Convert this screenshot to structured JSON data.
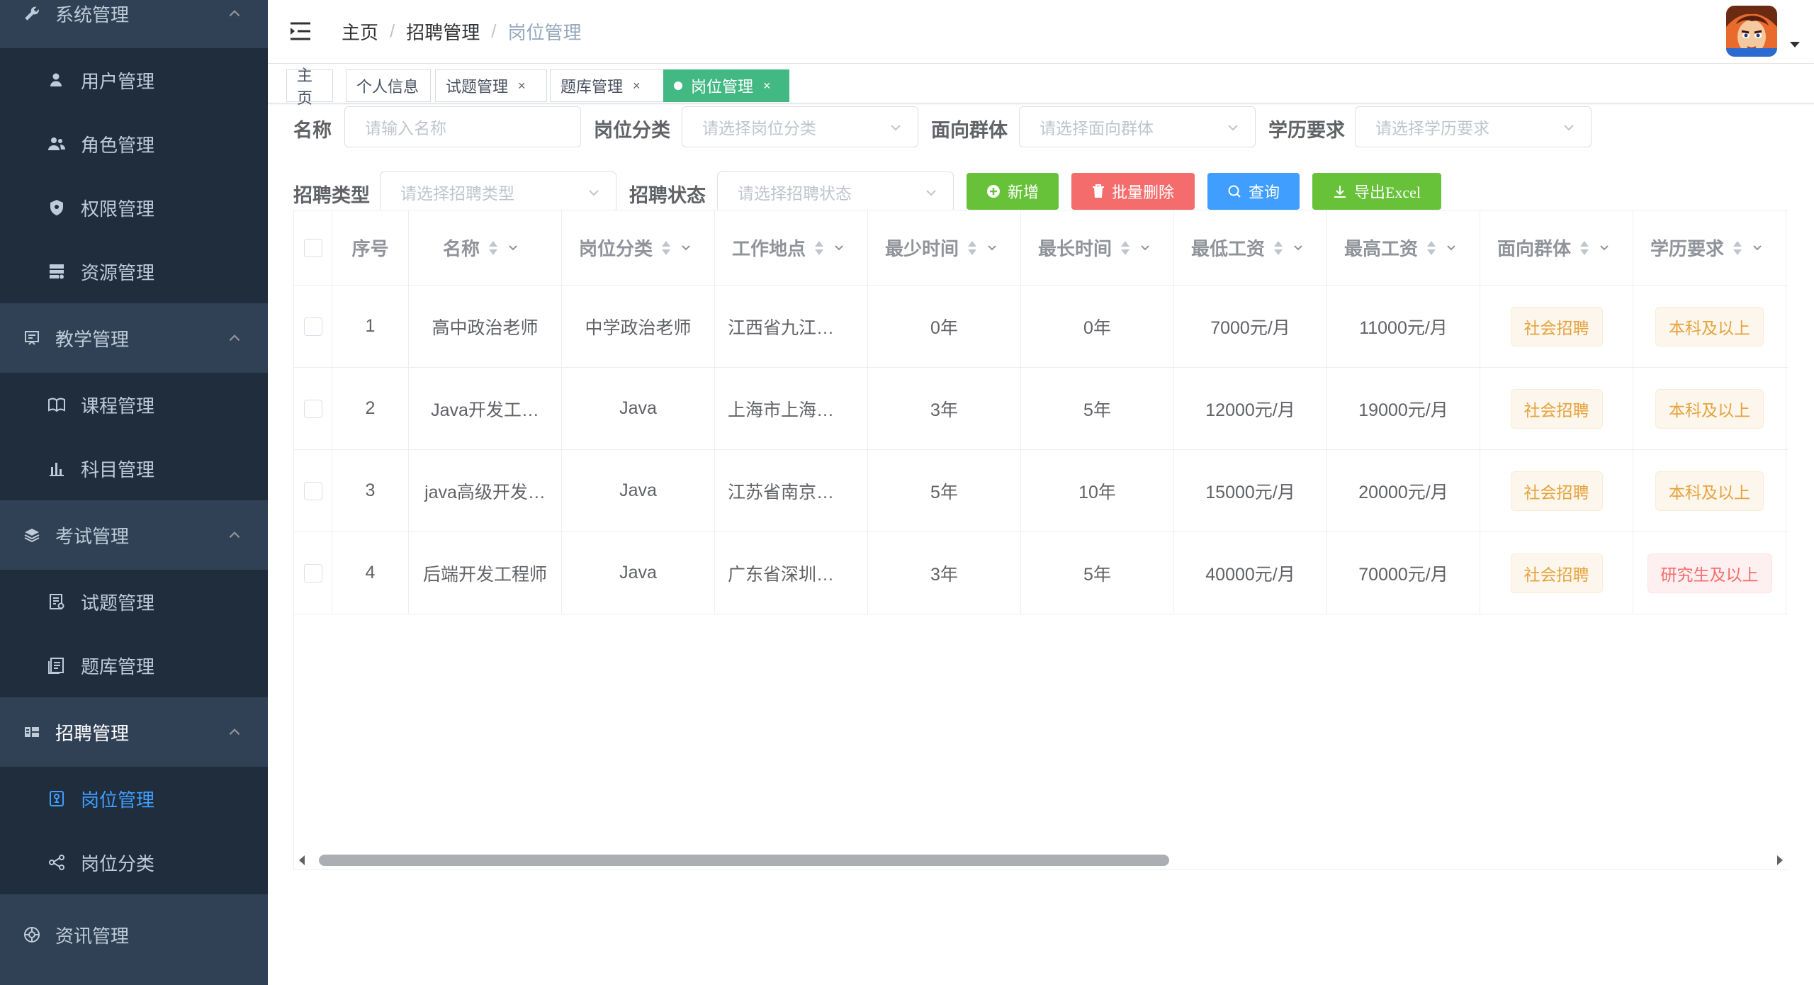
{
  "sidebar": {
    "groups": [
      {
        "label": "系统管理",
        "icon": "wrench-icon"
      },
      {
        "label": "教学管理",
        "icon": "book-open-icon"
      },
      {
        "label": "考试管理",
        "icon": "layers-icon"
      },
      {
        "label": "招聘管理",
        "icon": "recruit-icon"
      },
      {
        "label": "资讯管理",
        "icon": "news-icon"
      }
    ],
    "items": [
      {
        "label": "用户管理",
        "icon": "user-icon"
      },
      {
        "label": "角色管理",
        "icon": "users-icon"
      },
      {
        "label": "权限管理",
        "icon": "shield-icon"
      },
      {
        "label": "资源管理",
        "icon": "server-icon"
      },
      {
        "label": "课程管理",
        "icon": "course-book-icon"
      },
      {
        "label": "科目管理",
        "icon": "bar-chart-icon"
      },
      {
        "label": "试题管理",
        "icon": "exam-doc-icon"
      },
      {
        "label": "题库管理",
        "icon": "question-bank-icon"
      },
      {
        "label": "岗位管理",
        "icon": "position-icon"
      },
      {
        "label": "岗位分类",
        "icon": "share-nodes-icon"
      }
    ],
    "active_color": "#409eff"
  },
  "header": {
    "breadcrumb": [
      "主页",
      "招聘管理",
      "岗位管理"
    ],
    "separator": "/"
  },
  "tags": [
    {
      "label": "主页"
    },
    {
      "label": "个人信息"
    },
    {
      "label": "试题管理",
      "close": "×"
    },
    {
      "label": "题库管理",
      "close": "×"
    },
    {
      "label": "岗位管理",
      "close": "×"
    }
  ],
  "filters": {
    "name": {
      "label": "名称",
      "placeholder": "请输入名称"
    },
    "category": {
      "label": "岗位分类",
      "placeholder": "请选择岗位分类"
    },
    "audience": {
      "label": "面向群体",
      "placeholder": "请选择面向群体"
    },
    "education": {
      "label": "学历要求",
      "placeholder": "请选择学历要求"
    },
    "recruit_type": {
      "label": "招聘类型",
      "placeholder": "请选择招聘类型"
    },
    "recruit_status": {
      "label": "招聘状态",
      "placeholder": "请选择招聘状态"
    }
  },
  "buttons": {
    "add": "新增",
    "batch_delete": "批量删除",
    "query": "查询",
    "export": "导出Excel"
  },
  "table": {
    "columns": [
      "序号",
      "名称",
      "岗位分类",
      "工作地点",
      "最少时间",
      "最长时间",
      "最低工资",
      "最高工资",
      "面向群体",
      "学历要求"
    ],
    "rows": [
      {
        "no": "1",
        "name": "高中政治老师",
        "category": "中学政治老师",
        "location": "江西省九江…",
        "min_time": "0年",
        "max_time": "0年",
        "min_salary": "7000元/月",
        "max_salary": "11000元/月",
        "audience": "社会招聘",
        "education": "本科及以上",
        "edu_type": "warn"
      },
      {
        "no": "2",
        "name": "Java开发工…",
        "category": "Java",
        "location": "上海市上海…",
        "min_time": "3年",
        "max_time": "5年",
        "min_salary": "12000元/月",
        "max_salary": "19000元/月",
        "audience": "社会招聘",
        "education": "本科及以上",
        "edu_type": "warn"
      },
      {
        "no": "3",
        "name": "java高级开发…",
        "category": "Java",
        "location": "江苏省南京…",
        "min_time": "5年",
        "max_time": "10年",
        "min_salary": "15000元/月",
        "max_salary": "20000元/月",
        "audience": "社会招聘",
        "education": "本科及以上",
        "edu_type": "warn"
      },
      {
        "no": "4",
        "name": "后端开发工程师",
        "category": "Java",
        "location": "广东省深圳…",
        "min_time": "3年",
        "max_time": "5年",
        "min_salary": "40000元/月",
        "max_salary": "70000元/月",
        "audience": "社会招聘",
        "education": "研究生及以上",
        "edu_type": "danger"
      }
    ]
  },
  "colors": {
    "sidebar_bg": "#304156",
    "submenu_bg": "#1f2d3d",
    "active_tag": "#42b983",
    "success": "#67c23a",
    "danger": "#f56c6c",
    "primary": "#409eff",
    "warning": "#e6a23c"
  }
}
